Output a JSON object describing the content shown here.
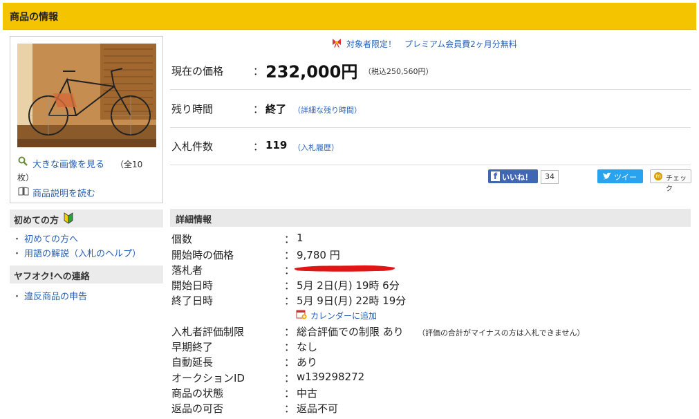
{
  "header": {
    "title": "商品の情報"
  },
  "images": {
    "view_large_label": "大きな画像を見る",
    "count_label": "（全10",
    "count_label2": "枚）",
    "description_label": "商品説明を読む"
  },
  "sidebar": {
    "beginner": {
      "heading": "初めての方",
      "items": [
        "初めての方へ",
        "用語の解説（入札のヘルプ）"
      ]
    },
    "contact": {
      "heading": "ヤフオク!への連絡",
      "items": [
        "違反商品の申告"
      ]
    },
    "bullet": "・"
  },
  "promo": {
    "text": "対象者限定！　プレミアム会員費2ヶ月分無料"
  },
  "summary": {
    "price_label": "現在の価格",
    "price_value": "232,000円",
    "price_tax": "（税込250,560円）",
    "time_label": "残り時間",
    "time_value": "終了",
    "time_link": "（詳細な残り時間）",
    "bids_label": "入札件数",
    "bids_value": "119",
    "bids_link": "（入札履歴）",
    "colon": "："
  },
  "social": {
    "like_label": "いいね！",
    "like_count": "34",
    "tweet_label": "ツイート",
    "check_label": "チェック"
  },
  "details": {
    "heading": "詳細情報",
    "colon": "：",
    "calendar_link": "カレンダーに追加",
    "rows": [
      {
        "label": "個数",
        "value": "1"
      },
      {
        "label": "開始時の価格",
        "value": "9,780 円"
      },
      {
        "label": "落札者",
        "value": ""
      },
      {
        "label": "開始日時",
        "value": "5月 2日(月) 19時 6分"
      },
      {
        "label": "終了日時",
        "value": "5月 9日(月) 22時 19分"
      },
      {
        "label": "入札者評価制限",
        "value": "総合評価での制限 あり",
        "note": "（評価の合計がマイナスの方は入札できません）"
      },
      {
        "label": "早期終了",
        "value": "なし"
      },
      {
        "label": "自動延長",
        "value": "あり"
      },
      {
        "label": "オークションID",
        "value": "w139298272"
      },
      {
        "label": "商品の状態",
        "value": "中古"
      },
      {
        "label": "返品の可否",
        "value": "返品不可"
      }
    ]
  },
  "colors": {
    "header_bg": "#f5c400",
    "link": "#2962b6",
    "redaction": "#e01515"
  }
}
